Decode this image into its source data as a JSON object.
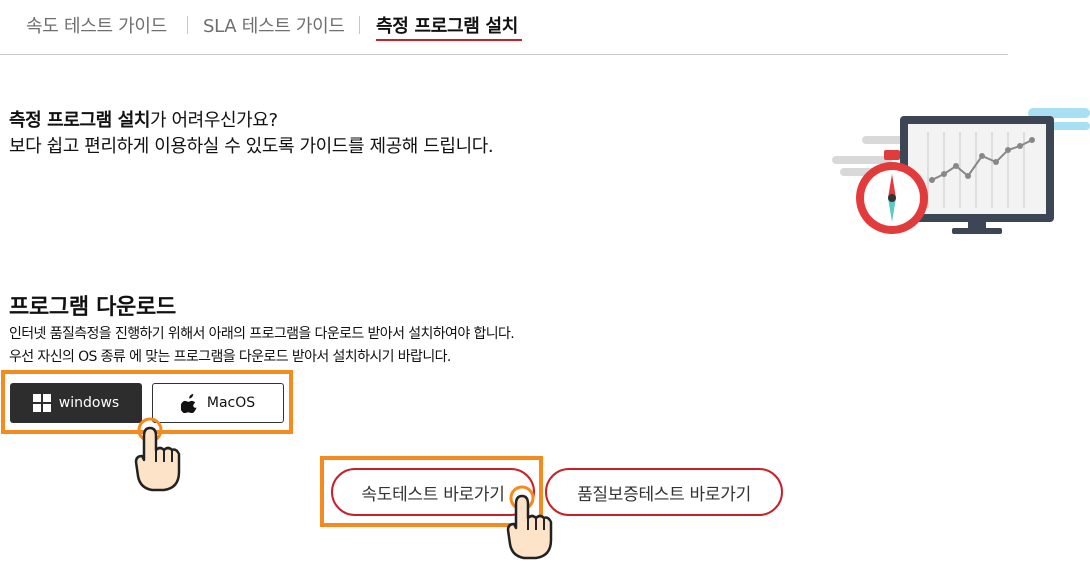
{
  "tabs": {
    "speed_guide": "속도 테스트 가이드",
    "sla_guide": "SLA 테스트 가이드",
    "install": "측정 프로그램 설치"
  },
  "intro": {
    "strong": "측정 프로그램 설치",
    "line1_rest": "가 어려우신가요?",
    "line2": "보다 쉽고 편리하게 이용하실 수 있도록 가이드를 제공해 드립니다."
  },
  "download": {
    "title": "프로그램 다운로드",
    "desc_line1": "인터넷 품질측정을 진행하기 위해서 아래의 프로그램을 다운로드 받아서 설치하여야 합니다.",
    "desc_line2": "우선 자신의 OS 종류 에 맞는 프로그램을 다운로드 받아서 설치하시기 바랍니다.",
    "windows_label": "windows",
    "mac_label": "MacOS"
  },
  "links": {
    "speed_test": "속도테스트 바로가기",
    "quality_test": "품질보증테스트 바로가기"
  },
  "colors": {
    "accent_red": "#c8202b",
    "highlight_orange": "#f58a1f",
    "dark_button": "#2d2d2d"
  },
  "icons": [
    "windows-icon",
    "apple-icon",
    "pointer-hand-icon",
    "monitor-stopwatch-illustration"
  ]
}
